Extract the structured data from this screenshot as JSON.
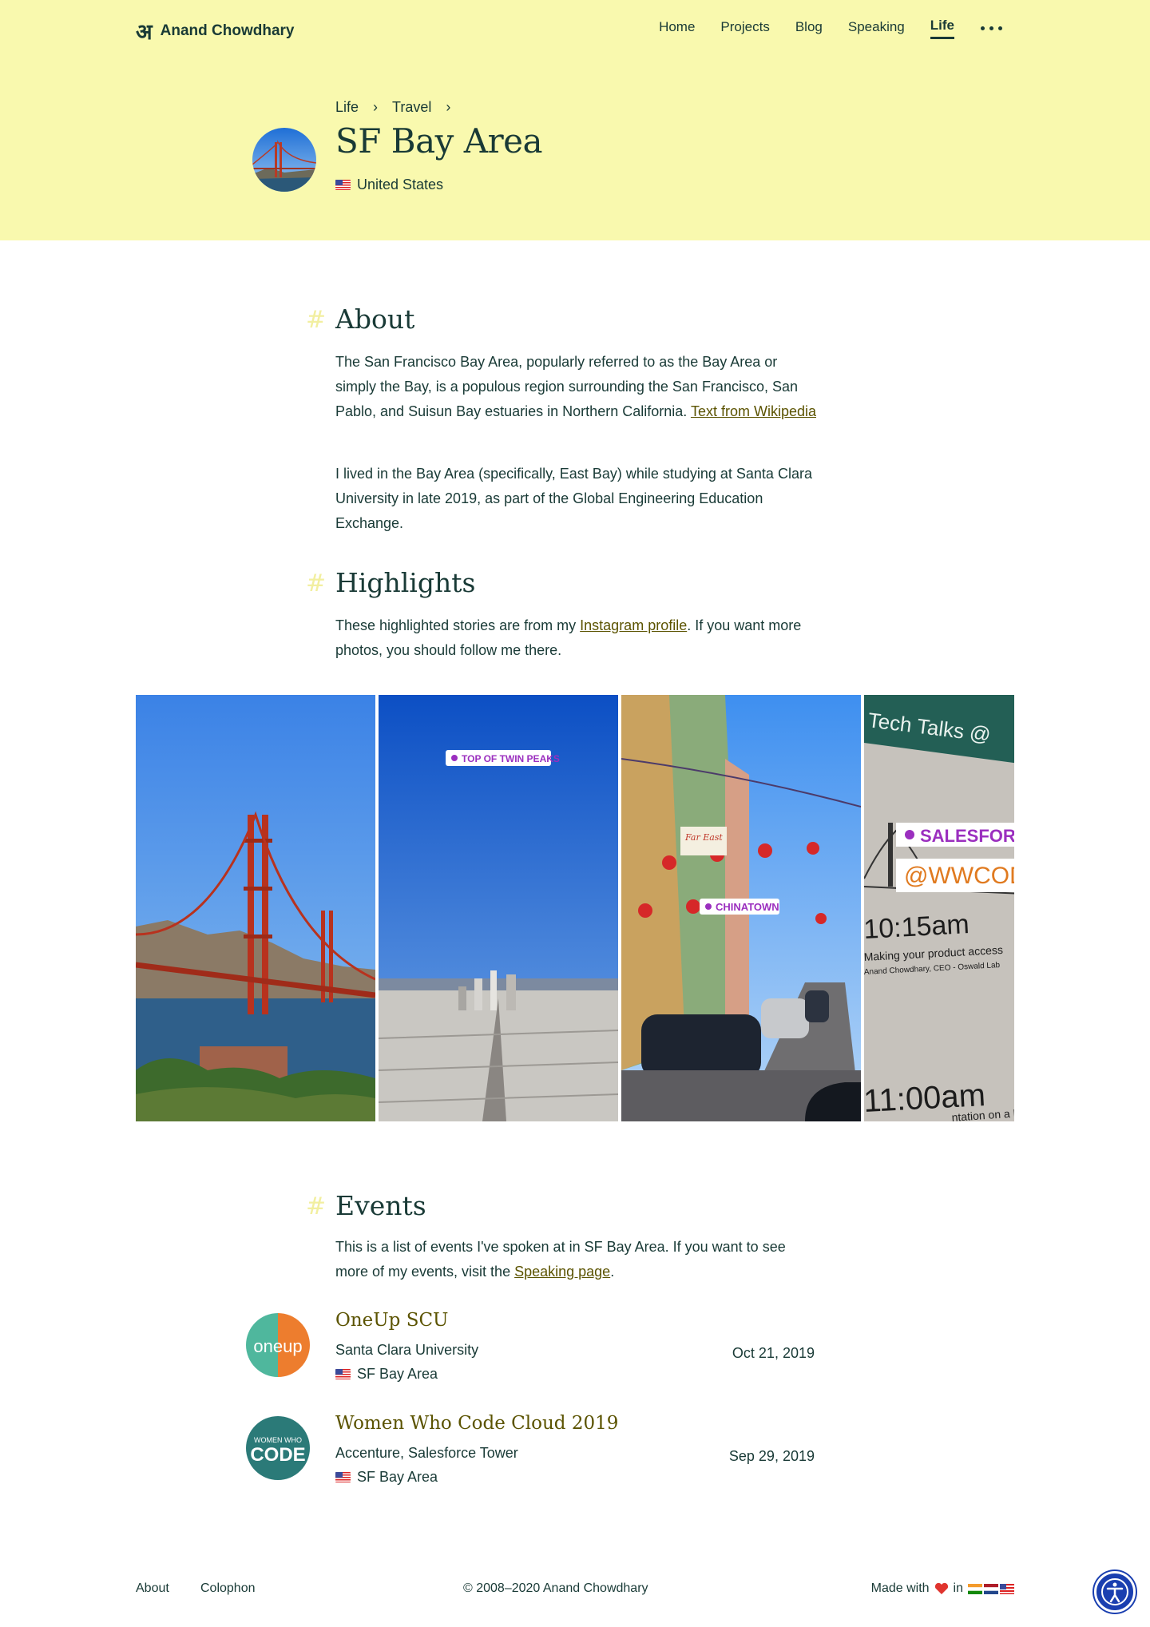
{
  "brand": {
    "logo_mark": "अ",
    "name": "Anand Chowdhary"
  },
  "nav": {
    "items": [
      {
        "label": "Home"
      },
      {
        "label": "Projects"
      },
      {
        "label": "Blog"
      },
      {
        "label": "Speaking"
      },
      {
        "label": "Life",
        "active": true
      }
    ],
    "more_icon": "ellipsis-icon"
  },
  "breadcrumb": [
    "Life",
    "Travel"
  ],
  "breadcrumb_separator": "›",
  "page": {
    "title": "SF Bay Area",
    "country": "United States",
    "country_flag": "us-flag-icon"
  },
  "about": {
    "heading": "About",
    "hash": "#",
    "p1_text": "The San Francisco Bay Area, popularly referred to as the Bay Area or simply the Bay, is a populous region surrounding the San Francisco, San Pablo, and Suisun Bay estuaries in Northern California.",
    "p1_link": "Text from Wikipedia",
    "p2": "I lived in the Bay Area (specifically, East Bay) while studying at Santa Clara University in late 2019, as part of the Global Engineering Education Exchange."
  },
  "highlights": {
    "heading": "Highlights",
    "p_before": "These highlighted stories are from my",
    "p_link": "Instagram profile",
    "p_after": ". If you want more photos, you should follow me there.",
    "stories": [
      {
        "name": "golden-gate"
      },
      {
        "name": "twin-peaks",
        "tag": "TOP OF TWIN PEAKS"
      },
      {
        "name": "chinatown",
        "tag": "CHINATOWN",
        "sign": "Far East"
      },
      {
        "name": "salesforce",
        "tag": "SALESFORCE",
        "banner": "Tech Talks @",
        "handle": "@WWCODE",
        "time1": "10:15am",
        "line1": "Making your product access",
        "line2": "Anand Chowdhary, CEO - Oswald Lab",
        "time2": "11:00am",
        "line3": "ntation on a NoS"
      }
    ]
  },
  "events": {
    "heading": "Events",
    "p_before": "This is a list of events I've spoken at in SF Bay Area. If you want to see more of my events, visit the",
    "p_link": "Speaking page",
    "p_after": ".",
    "items": [
      {
        "title": "OneUp SCU",
        "venue": "Santa Clara University",
        "place": "SF Bay Area",
        "date": "Oct 21, 2019",
        "logo_text": "oneup"
      },
      {
        "title": "Women Who Code Cloud 2019",
        "venue": "Accenture, Salesforce Tower",
        "place": "SF Bay Area",
        "date": "Sep 29, 2019",
        "logo_small": "WOMEN WHO",
        "logo_big": "CODE"
      }
    ]
  },
  "footer": {
    "links": [
      "About",
      "Colophon"
    ],
    "copyright": "© 2008–2020 Anand Chowdhary",
    "made_with": "Made with",
    "in": "in"
  },
  "accessibility_icon": "accessibility-icon"
}
